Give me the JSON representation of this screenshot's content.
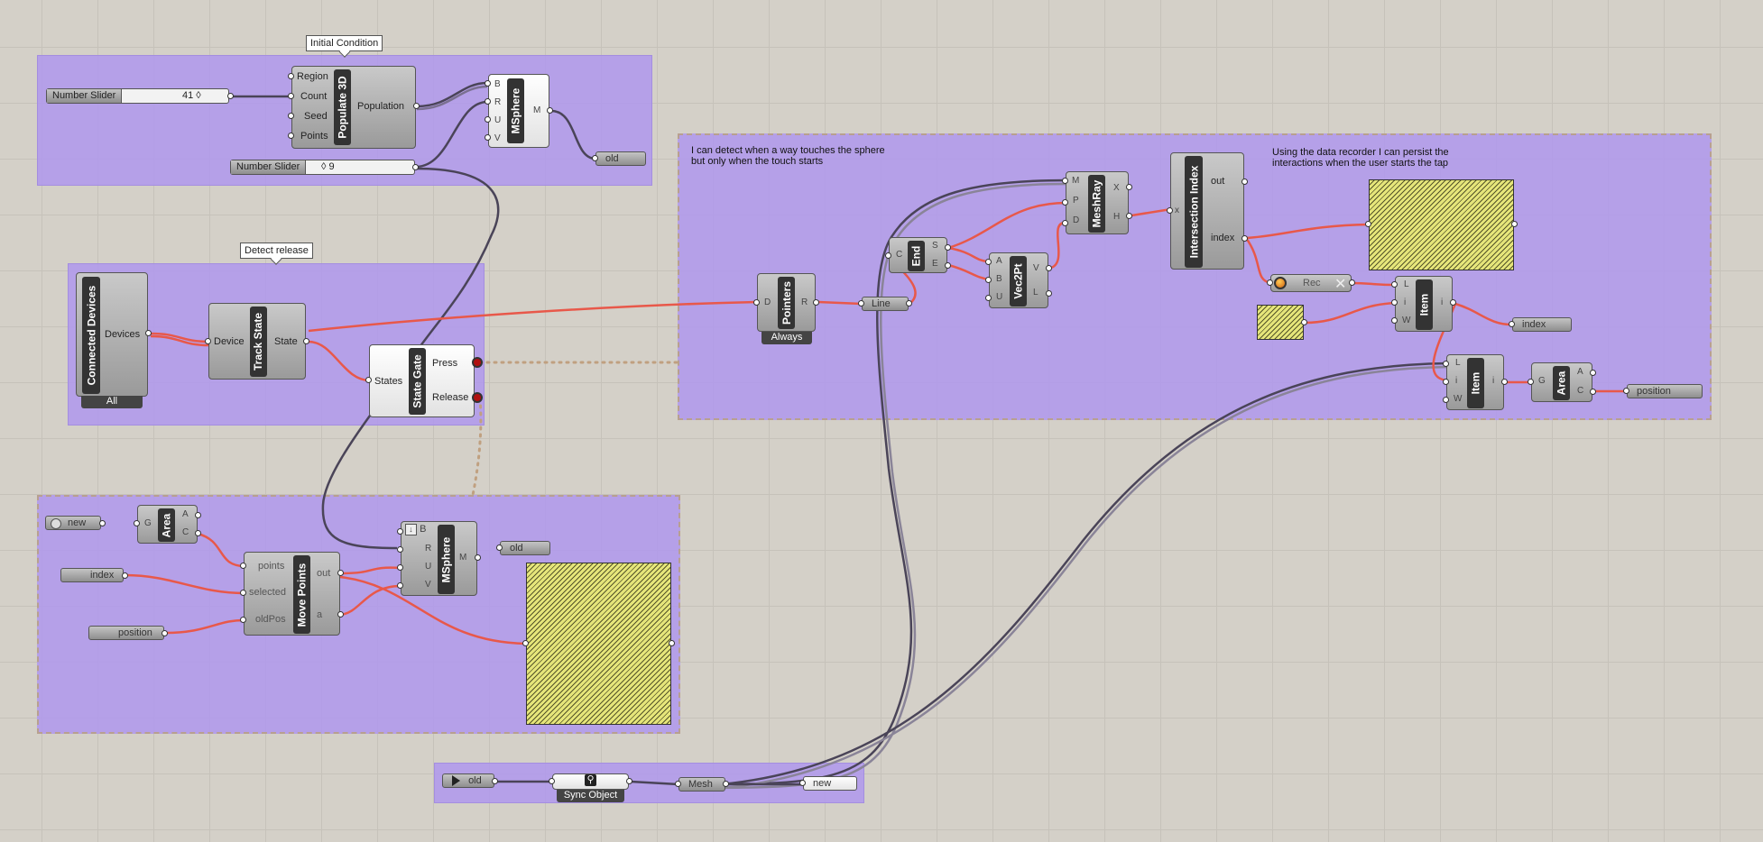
{
  "groups": {
    "initial_condition": {
      "note": "Initial Condition"
    },
    "detect_release": {
      "note": "Detect release"
    },
    "detect_touch": {
      "comment1_line1": "I can detect when a way touches the sphere",
      "comment1_line2": " but only when the touch starts",
      "comment2_line1": "Using the data recorder I can persist the",
      "comment2_line2": "interactions when the user starts the tap"
    }
  },
  "sliders": [
    {
      "name": "Number Slider",
      "value": "41 ◊"
    },
    {
      "name": "Number Slider",
      "value": "◊ 9"
    }
  ],
  "populate3d": {
    "title": "Populate 3D",
    "inputs": [
      "Region",
      "Count",
      "Seed",
      "Points"
    ],
    "output": "Population"
  },
  "msphere_top": {
    "title": "MSphere",
    "inputs": [
      "B",
      "R",
      "U",
      "V"
    ],
    "output": "M"
  },
  "param_old_top": {
    "label": "old"
  },
  "connected_devices": {
    "title": "Connected Devices",
    "output": "Devices",
    "tag": "All"
  },
  "track_state": {
    "title": "Track State",
    "input": "Device",
    "output": "State"
  },
  "state_gate": {
    "title": "State Gate",
    "input": "States",
    "outputs": [
      "Press",
      "Release"
    ]
  },
  "pointers": {
    "title": "Pointers",
    "inputs": [
      "D"
    ],
    "output": "R",
    "tag": "Always"
  },
  "line_param": {
    "label": "Line"
  },
  "end": {
    "title": "End",
    "input": "C",
    "outputs": [
      "S",
      "E"
    ]
  },
  "vec2pt": {
    "title": "Vec2Pt",
    "inputs": [
      "A",
      "B",
      "U"
    ],
    "outputs": [
      "V",
      "L"
    ]
  },
  "meshray": {
    "title": "MeshRay",
    "inputs": [
      "M",
      "P",
      "D"
    ],
    "outputs": [
      "X",
      "H"
    ]
  },
  "intersection_index": {
    "title": "Intersection Index",
    "input": "x",
    "outputs": [
      "out",
      "index"
    ]
  },
  "recorder": {
    "label": "Rec"
  },
  "item1": {
    "title": "Item",
    "inputs": [
      "L",
      "i",
      "W"
    ],
    "output": "i"
  },
  "item2": {
    "title": "Item",
    "inputs": [
      "L",
      "i",
      "W"
    ],
    "output": "i"
  },
  "area_right": {
    "title": "Area",
    "input": "G",
    "outputs": [
      "A",
      "C"
    ]
  },
  "param_index_right": {
    "label": "index"
  },
  "param_position_right": {
    "label": "position"
  },
  "param_new_left": {
    "label": "new"
  },
  "area_left": {
    "title": "Area",
    "input": "G",
    "outputs": [
      "A",
      "C"
    ]
  },
  "param_index_left": {
    "label": "index"
  },
  "param_position_left": {
    "label": "position"
  },
  "move_points": {
    "title": "Move Points",
    "inputs": [
      "points",
      "selected",
      "oldPos"
    ],
    "outputs": [
      "out",
      "a"
    ]
  },
  "msphere_bottom": {
    "title": "MSphere",
    "inputs": [
      "B",
      "R",
      "U",
      "V"
    ],
    "output": "M"
  },
  "param_old_mid": {
    "label": "old"
  },
  "sync": {
    "old_label": "old",
    "tag": "Sync Object",
    "mesh_label": "Mesh",
    "new_label": "new"
  },
  "colors": {
    "group_fill": "#b098ec",
    "wire_red": "#e8584a",
    "wire_dark": "#4a4458",
    "swatch": "#e6e67a"
  }
}
